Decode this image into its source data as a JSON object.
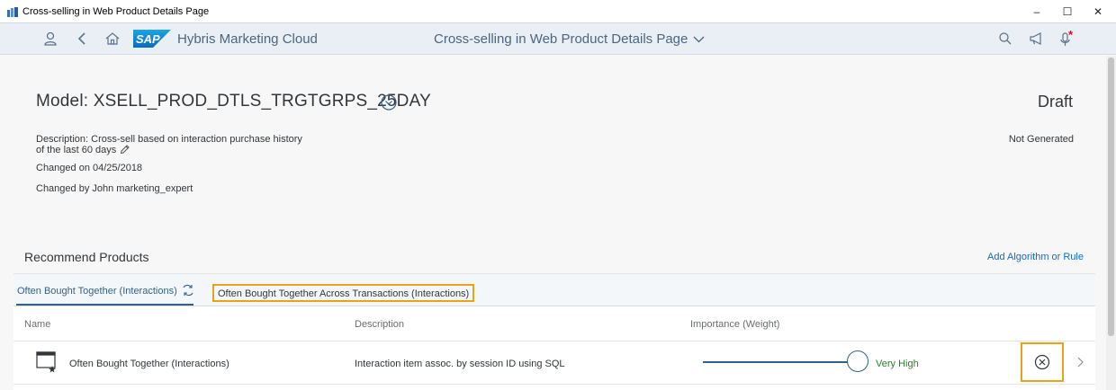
{
  "window": {
    "title": "Cross-selling in Web Product Details Page",
    "minimize": "–",
    "maximize": "☐",
    "close": "✕"
  },
  "shell": {
    "app_name": "Hybris Marketing Cloud",
    "page_title": "Cross-selling in Web Product Details Page",
    "icons": [
      "user-icon",
      "back-icon",
      "home-icon",
      "search-icon",
      "megaphone-icon",
      "microphone-icon"
    ],
    "notification_color": "#e30b1b"
  },
  "header": {
    "model_title": "Model: XSELL_PROD_DTLS_TRGTGRPS_25DAY",
    "status": "Draft",
    "description_line1": "Description: Cross-sell based on interaction purchase history",
    "description_line2": "of the last 60 days",
    "changed_on": "Changed on 04/25/2018",
    "changed_by": "Changed by John marketing_expert",
    "generation_status": "Not Generated"
  },
  "section": {
    "title": "Recommend Products",
    "add_action": "Add Algorithm or Rule",
    "tabs": [
      {
        "label": "Often Bought Together (Interactions)",
        "selected": true
      },
      {
        "label": "Often Bought Together Across Transactions (Interactions)",
        "selected": false,
        "highlighted": true
      }
    ],
    "table": {
      "columns": [
        "Name",
        "Description",
        "Importance (Weight)"
      ],
      "rows": [
        {
          "name": "Often Bought Together (Interactions)",
          "description": "Interaction item assoc. by session ID using SQL",
          "importance_label": "Very High",
          "importance_level": 1.0
        }
      ]
    }
  },
  "colors": {
    "accent": "#346187",
    "link": "#0a6ed1",
    "highlight_border": "#e8a317",
    "positive": "#2b7d2b"
  }
}
